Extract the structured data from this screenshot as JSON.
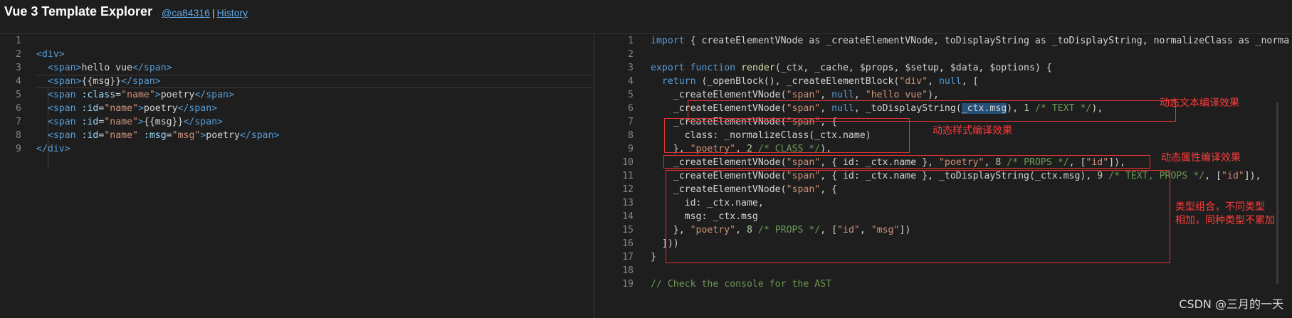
{
  "header": {
    "title": "Vue 3 Template Explorer",
    "commit_link": "@ca84316",
    "separator": "|",
    "history_link": "History"
  },
  "template_code": [
    {
      "n": "1",
      "tokens": []
    },
    {
      "n": "2",
      "tokens": [
        {
          "t": "<div>",
          "c": "tag"
        }
      ]
    },
    {
      "n": "3",
      "tokens": [
        {
          "t": "  <span>",
          "c": "tag"
        },
        {
          "t": "hello vue",
          "c": ""
        },
        {
          "t": "</span>",
          "c": "tag"
        }
      ]
    },
    {
      "n": "4",
      "tokens": [
        {
          "t": "  <span>",
          "c": "tag"
        },
        {
          "t": "{{msg}}",
          "c": ""
        },
        {
          "t": "</span>",
          "c": "tag"
        }
      ]
    },
    {
      "n": "5",
      "tokens": [
        {
          "t": "  <span ",
          "c": "tag"
        },
        {
          "t": ":class",
          "c": "attr"
        },
        {
          "t": "=",
          "c": ""
        },
        {
          "t": "\"name\"",
          "c": "str"
        },
        {
          "t": ">",
          "c": "tag"
        },
        {
          "t": "poetry",
          "c": ""
        },
        {
          "t": "</span>",
          "c": "tag"
        }
      ]
    },
    {
      "n": "6",
      "tokens": [
        {
          "t": "  <span ",
          "c": "tag"
        },
        {
          "t": ":id",
          "c": "attr"
        },
        {
          "t": "=",
          "c": ""
        },
        {
          "t": "\"name\"",
          "c": "str"
        },
        {
          "t": ">",
          "c": "tag"
        },
        {
          "t": "poetry",
          "c": ""
        },
        {
          "t": "</span>",
          "c": "tag"
        }
      ]
    },
    {
      "n": "7",
      "tokens": [
        {
          "t": "  <span ",
          "c": "tag"
        },
        {
          "t": ":id",
          "c": "attr"
        },
        {
          "t": "=",
          "c": ""
        },
        {
          "t": "\"name\"",
          "c": "str"
        },
        {
          "t": ">",
          "c": "tag"
        },
        {
          "t": "{{msg}}",
          "c": ""
        },
        {
          "t": "</span>",
          "c": "tag"
        }
      ]
    },
    {
      "n": "8",
      "tokens": [
        {
          "t": "  <span ",
          "c": "tag"
        },
        {
          "t": ":id",
          "c": "attr"
        },
        {
          "t": "=",
          "c": ""
        },
        {
          "t": "\"name\"",
          "c": "str"
        },
        {
          "t": " ",
          "c": ""
        },
        {
          "t": ":msg",
          "c": "attr"
        },
        {
          "t": "=",
          "c": ""
        },
        {
          "t": "\"msg\"",
          "c": "str"
        },
        {
          "t": ">",
          "c": "tag"
        },
        {
          "t": "poetry",
          "c": ""
        },
        {
          "t": "</span>",
          "c": "tag"
        }
      ]
    },
    {
      "n": "9",
      "tokens": [
        {
          "t": "</div>",
          "c": "tag"
        }
      ]
    }
  ],
  "output_code": [
    {
      "n": "1",
      "tokens": [
        {
          "t": "import",
          "c": "kw"
        },
        {
          "t": " { createElementVNode as _createElementVNode, toDisplayString as _toDisplayString, normalizeClass as _norma",
          "c": ""
        }
      ]
    },
    {
      "n": "2",
      "tokens": []
    },
    {
      "n": "3",
      "tokens": [
        {
          "t": "export",
          "c": "kw"
        },
        {
          "t": " ",
          "c": ""
        },
        {
          "t": "function",
          "c": "kw"
        },
        {
          "t": " ",
          "c": ""
        },
        {
          "t": "render",
          "c": "fn"
        },
        {
          "t": "(_ctx, _cache, $props, $setup, $data, $options) {",
          "c": ""
        }
      ]
    },
    {
      "n": "4",
      "tokens": [
        {
          "t": "  ",
          "c": ""
        },
        {
          "t": "return",
          "c": "kw"
        },
        {
          "t": " (_openBlock(), _createElementBlock(",
          "c": ""
        },
        {
          "t": "\"div\"",
          "c": "str"
        },
        {
          "t": ", ",
          "c": ""
        },
        {
          "t": "null",
          "c": "kw"
        },
        {
          "t": ", [",
          "c": ""
        }
      ]
    },
    {
      "n": "5",
      "tokens": [
        {
          "t": "    _createElementVNode(",
          "c": ""
        },
        {
          "t": "\"span\"",
          "c": "str"
        },
        {
          "t": ", ",
          "c": ""
        },
        {
          "t": "null",
          "c": "kw"
        },
        {
          "t": ", ",
          "c": ""
        },
        {
          "t": "\"hello vue\"",
          "c": "str"
        },
        {
          "t": "),",
          "c": ""
        }
      ]
    },
    {
      "n": "6",
      "tokens": [
        {
          "t": "    _createElementVNode(",
          "c": ""
        },
        {
          "t": "\"span\"",
          "c": "str"
        },
        {
          "t": ", ",
          "c": ""
        },
        {
          "t": "null",
          "c": "kw"
        },
        {
          "t": ", _toDisplayString(",
          "c": ""
        },
        {
          "t": "_ctx.msg",
          "c": "sel"
        },
        {
          "t": "), ",
          "c": ""
        },
        {
          "t": "1",
          "c": "num"
        },
        {
          "t": " /* TEXT */",
          "c": "cmt"
        },
        {
          "t": "),",
          "c": ""
        }
      ]
    },
    {
      "n": "7",
      "tokens": [
        {
          "t": "    _createElementVNode(",
          "c": ""
        },
        {
          "t": "\"span\"",
          "c": "str"
        },
        {
          "t": ", {",
          "c": ""
        }
      ]
    },
    {
      "n": "8",
      "tokens": [
        {
          "t": "      class: _normalizeClass(_ctx.name)",
          "c": ""
        }
      ]
    },
    {
      "n": "9",
      "tokens": [
        {
          "t": "    }, ",
          "c": ""
        },
        {
          "t": "\"poetry\"",
          "c": "str"
        },
        {
          "t": ", ",
          "c": ""
        },
        {
          "t": "2",
          "c": "num"
        },
        {
          "t": " /* CLASS */",
          "c": "cmt"
        },
        {
          "t": "),",
          "c": ""
        }
      ]
    },
    {
      "n": "10",
      "tokens": [
        {
          "t": "    _createElementVNode(",
          "c": ""
        },
        {
          "t": "\"span\"",
          "c": "str"
        },
        {
          "t": ", { id: _ctx.name }, ",
          "c": ""
        },
        {
          "t": "\"poetry\"",
          "c": "str"
        },
        {
          "t": ", ",
          "c": ""
        },
        {
          "t": "8",
          "c": "num"
        },
        {
          "t": " /* PROPS */",
          "c": "cmt"
        },
        {
          "t": ", [",
          "c": ""
        },
        {
          "t": "\"id\"",
          "c": "str"
        },
        {
          "t": "]),",
          "c": ""
        }
      ]
    },
    {
      "n": "11",
      "tokens": [
        {
          "t": "    _createElementVNode(",
          "c": ""
        },
        {
          "t": "\"span\"",
          "c": "str"
        },
        {
          "t": ", { id: _ctx.name }, _toDisplayString(_ctx.msg), ",
          "c": ""
        },
        {
          "t": "9",
          "c": "num"
        },
        {
          "t": " /* TEXT, PROPS */",
          "c": "cmt"
        },
        {
          "t": ", [",
          "c": ""
        },
        {
          "t": "\"id\"",
          "c": "str"
        },
        {
          "t": "]),",
          "c": ""
        }
      ]
    },
    {
      "n": "12",
      "tokens": [
        {
          "t": "    _createElementVNode(",
          "c": ""
        },
        {
          "t": "\"span\"",
          "c": "str"
        },
        {
          "t": ", {",
          "c": ""
        }
      ]
    },
    {
      "n": "13",
      "tokens": [
        {
          "t": "      id: _ctx.name,",
          "c": ""
        }
      ]
    },
    {
      "n": "14",
      "tokens": [
        {
          "t": "      msg: _ctx.msg",
          "c": ""
        }
      ]
    },
    {
      "n": "15",
      "tokens": [
        {
          "t": "    }, ",
          "c": ""
        },
        {
          "t": "\"poetry\"",
          "c": "str"
        },
        {
          "t": ", ",
          "c": ""
        },
        {
          "t": "8",
          "c": "num"
        },
        {
          "t": " /* PROPS */",
          "c": "cmt"
        },
        {
          "t": ", [",
          "c": ""
        },
        {
          "t": "\"id\"",
          "c": "str"
        },
        {
          "t": ", ",
          "c": ""
        },
        {
          "t": "\"msg\"",
          "c": "str"
        },
        {
          "t": "])",
          "c": ""
        }
      ]
    },
    {
      "n": "16",
      "tokens": [
        {
          "t": "  ]))",
          "c": ""
        }
      ]
    },
    {
      "n": "17",
      "tokens": [
        {
          "t": "}",
          "c": ""
        }
      ]
    },
    {
      "n": "18",
      "tokens": []
    },
    {
      "n": "19",
      "tokens": [
        {
          "t": "// Check the console for the AST",
          "c": "cmt"
        }
      ]
    }
  ],
  "annotations": {
    "text": "动态文本编译效果",
    "class": "动态样式编译效果",
    "props": "动态属性编译效果",
    "combo_line1": "类型组合，不同类型",
    "combo_line2": "相加，同种类型不累加"
  },
  "watermark": "CSDN @三月的一天",
  "colors": {
    "background": "#1e1e1e",
    "tag": "#569cd6",
    "attribute": "#9cdcfe",
    "string": "#ce9178",
    "keyword": "#569cd6",
    "number": "#b5cea8",
    "comment": "#6a9955",
    "annotation": "#e03333",
    "link": "#5fa8e6"
  }
}
